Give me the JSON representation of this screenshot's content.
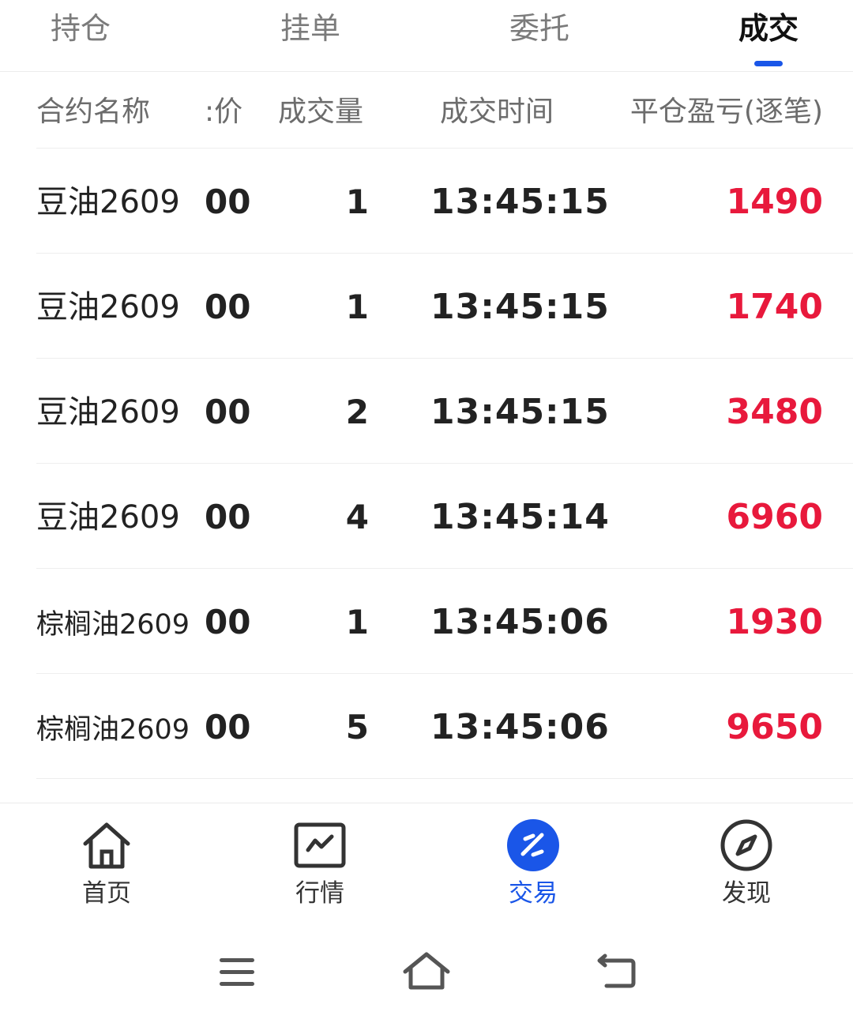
{
  "tabs": [
    {
      "label": "持仓",
      "active": false
    },
    {
      "label": "挂单",
      "active": false
    },
    {
      "label": "委托",
      "active": false
    },
    {
      "label": "成交",
      "active": true
    }
  ],
  "columns": {
    "name": "合约名称",
    "price": ":价",
    "volume": "成交量",
    "time": "成交时间",
    "pnl": "平仓盈亏(逐笔)"
  },
  "rows": [
    {
      "name": "豆油2609",
      "price": "00",
      "volume": "1",
      "time": "13:45:15",
      "pnl": "1490"
    },
    {
      "name": "豆油2609",
      "price": "00",
      "volume": "1",
      "time": "13:45:15",
      "pnl": "1740"
    },
    {
      "name": "豆油2609",
      "price": "00",
      "volume": "2",
      "time": "13:45:15",
      "pnl": "3480"
    },
    {
      "name": "豆油2609",
      "price": "00",
      "volume": "4",
      "time": "13:45:14",
      "pnl": "6960"
    },
    {
      "name": "棕榈油2609",
      "price": "00",
      "volume": "1",
      "time": "13:45:06",
      "pnl": "1930"
    },
    {
      "name": "棕榈油2609",
      "price": "00",
      "volume": "5",
      "time": "13:45:06",
      "pnl": "9650"
    }
  ],
  "nav": [
    {
      "label": "首页",
      "icon": "home-icon",
      "active": false
    },
    {
      "label": "行情",
      "icon": "chart-icon",
      "active": false
    },
    {
      "label": "交易",
      "icon": "trade-icon",
      "active": true
    },
    {
      "label": "发现",
      "icon": "compass-icon",
      "active": false
    }
  ],
  "system_nav": [
    "menu-icon",
    "home-outline-icon",
    "back-icon"
  ],
  "colors": {
    "accent": "#1a56e8",
    "profit": "#e8193c",
    "text": "#222222",
    "muted": "#7b7b7b"
  }
}
